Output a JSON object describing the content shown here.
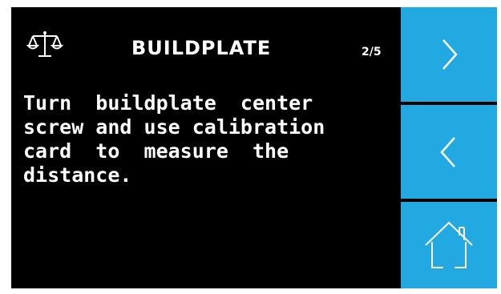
{
  "header": {
    "icon": "balance-scale-icon",
    "title": "BUILDPLATE",
    "page_counter": "2/5"
  },
  "instructions": "Turn  buildplate  center\nscrew and use calibration\ncard  to  measure  the\ndistance.",
  "buttons": {
    "next": {
      "icon": "chevron-right-icon"
    },
    "previous": {
      "icon": "chevron-left-icon"
    },
    "home": {
      "icon": "home-icon"
    }
  },
  "colors": {
    "background": "#000000",
    "text": "#ffffff",
    "button": "#22a9e1",
    "button_icon": "#ffffff"
  }
}
